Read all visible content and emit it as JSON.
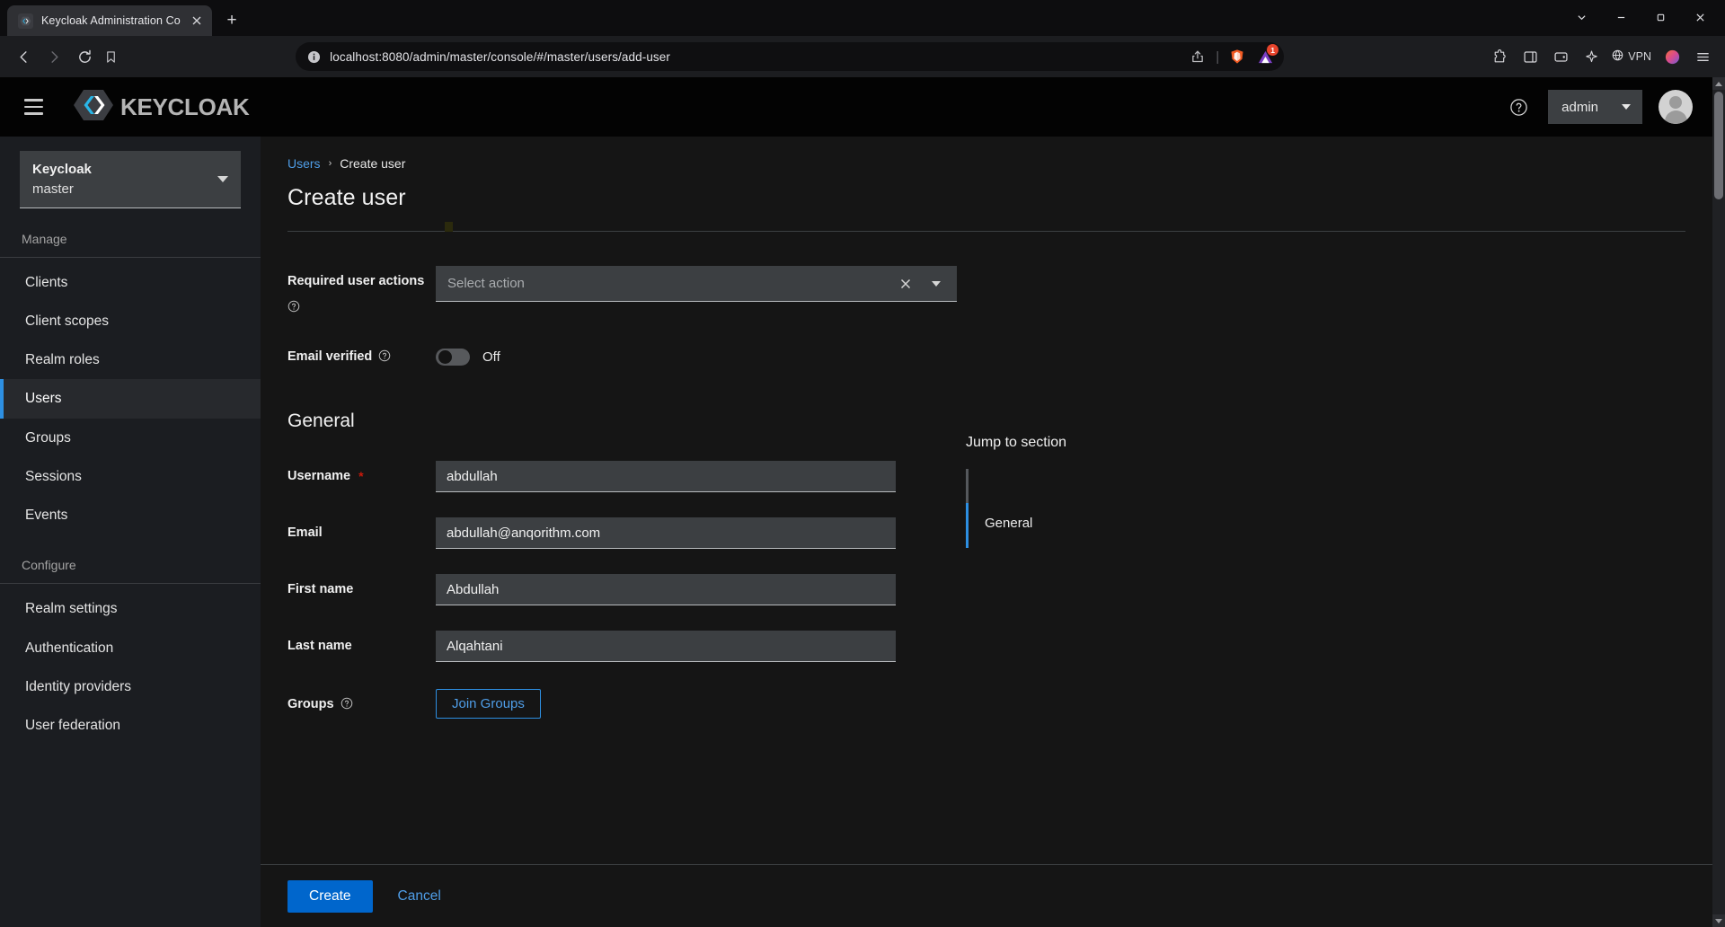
{
  "browser": {
    "tab": {
      "title": "Keycloak Administration Console",
      "favicon_icon": "keycloak-favicon",
      "close_icon": "close-icon"
    },
    "new_tab_label": "+",
    "window_controls": {
      "tab_search_icon": "chevron-down-icon",
      "minimize_icon": "minimize-icon",
      "maximize_icon": "maximize-icon",
      "close_icon": "window-close-icon"
    },
    "nav": {
      "back_icon": "back-arrow-icon",
      "forward_icon": "forward-arrow-icon",
      "reload_icon": "reload-icon",
      "bookmark_icon": "bookmark-icon"
    },
    "url": "localhost:8080/admin/master/console/#/master/users/add-user",
    "url_info_icon": "site-info-icon",
    "url_actions": {
      "share_icon": "share-icon",
      "brave_shields_icon": "brave-shields-icon",
      "extension_icon": "extension-triangle-icon",
      "extension_badge": "1"
    },
    "toolbar": {
      "extensions_icon": "puzzle-icon",
      "sidebar_icon": "sidebar-panel-icon",
      "wallet_icon": "wallet-icon",
      "leo_icon": "leo-ai-icon",
      "vpn_label": "VPN",
      "vpn_icon": "vpn-icon",
      "profile_icon": "profile-circle-icon",
      "menu_icon": "hamburger-menu-icon"
    }
  },
  "masthead": {
    "nav_toggle_icon": "hamburger-icon",
    "brand_text": "KEYCLOAK",
    "brand_logo_icon": "keycloak-logo-icon",
    "help_icon": "help-circle-icon",
    "user_menu_label": "admin",
    "user_menu_caret_icon": "caret-down-icon",
    "avatar_icon": "user-avatar-icon"
  },
  "sidebar": {
    "realm_selector": {
      "heading": "Keycloak",
      "value": "master",
      "caret_icon": "caret-down-icon"
    },
    "groups": [
      {
        "label": "Manage",
        "items": [
          {
            "label": "Clients",
            "active": false
          },
          {
            "label": "Client scopes",
            "active": false
          },
          {
            "label": "Realm roles",
            "active": false
          },
          {
            "label": "Users",
            "active": true
          },
          {
            "label": "Groups",
            "active": false
          },
          {
            "label": "Sessions",
            "active": false
          },
          {
            "label": "Events",
            "active": false
          }
        ]
      },
      {
        "label": "Configure",
        "items": [
          {
            "label": "Realm settings",
            "active": false
          },
          {
            "label": "Authentication",
            "active": false
          },
          {
            "label": "Identity providers",
            "active": false
          },
          {
            "label": "User federation",
            "active": false
          }
        ]
      }
    ]
  },
  "main": {
    "breadcrumb": {
      "parent": "Users",
      "separator": "›",
      "current": "Create user"
    },
    "page_title": "Create user",
    "required_user_actions": {
      "label": "Required user actions",
      "help_icon": "help-circle-icon",
      "placeholder": "Select action",
      "clear_icon": "clear-x-icon",
      "toggle_icon": "caret-down-icon"
    },
    "email_verified": {
      "label": "Email verified",
      "help_icon": "help-circle-icon",
      "state_label": "Off",
      "enabled": false
    },
    "general_section": {
      "title": "General",
      "fields": [
        {
          "label": "Username",
          "required": true,
          "value": "abdullah",
          "placeholder": ""
        },
        {
          "label": "Email",
          "required": false,
          "value": "abdullah@anqorithm.com",
          "placeholder": ""
        },
        {
          "label": "First name",
          "required": false,
          "value": "Abdullah",
          "placeholder": ""
        },
        {
          "label": "Last name",
          "required": false,
          "value": "Alqahtani",
          "placeholder": ""
        }
      ],
      "groups_field": {
        "label": "Groups",
        "help_icon": "help-circle-icon",
        "button_label": "Join Groups"
      }
    },
    "jump_to_section": {
      "title": "Jump to section",
      "items": [
        {
          "label": "General",
          "active": true
        }
      ]
    },
    "footer": {
      "primary_label": "Create",
      "secondary_label": "Cancel"
    }
  },
  "colors": {
    "accent_blue": "#0066cc",
    "link_blue": "#4f9ee8",
    "active_indicator": "#2d8fe2",
    "required_red": "#c9190b",
    "sidebar_bg": "#1b1d21",
    "content_bg": "#151515",
    "masthead_bg": "#030303",
    "field_bg": "#3c3f42"
  }
}
